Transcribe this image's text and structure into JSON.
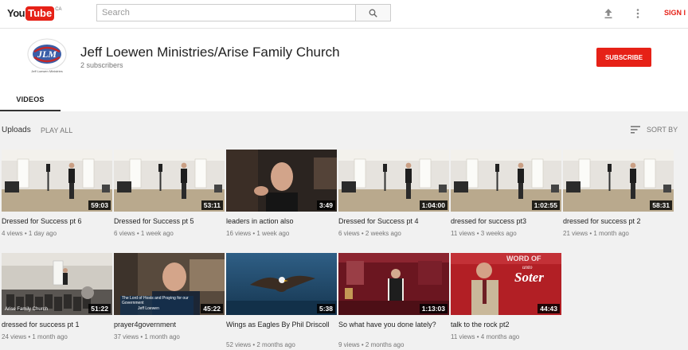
{
  "masthead": {
    "logo_you": "You",
    "logo_tube": "Tube",
    "logo_region": "CA",
    "search_placeholder": "Search",
    "sign_in": "SIGN I"
  },
  "channel": {
    "title": "Jeff Loewen Ministries/Arise Family Church",
    "subscribers": "2 subscribers",
    "subscribe_label": "SUBSCRIBE",
    "avatar_text": "JLM",
    "avatar_caption": "Jeff Loewen Ministries",
    "tab_videos": "VIDEOS"
  },
  "section": {
    "uploads": "Uploads",
    "play_all": "PLAY ALL",
    "sort_by": "SORT BY"
  },
  "videos": [
    {
      "title": "Dressed for Success pt 6",
      "meta": "4 views • 1 day ago",
      "duration": "59:03",
      "thumb": "hall-speaker"
    },
    {
      "title": "Dressed for Success pt 5",
      "meta": "6 views • 1 week ago",
      "duration": "53:11",
      "thumb": "hall-speaker"
    },
    {
      "title": "leaders in action also",
      "meta": "16 views • 1 week ago",
      "duration": "3:49",
      "thumb": "selfie-man"
    },
    {
      "title": "Dressed for Success pt 4",
      "meta": "6 views • 2 weeks ago",
      "duration": "1:04:00",
      "thumb": "hall-speaker"
    },
    {
      "title": "dressed for success pt3",
      "meta": "11 views • 3 weeks ago",
      "duration": "1:02:55",
      "thumb": "hall-speaker"
    },
    {
      "title": "dressed for success pt 2",
      "meta": "21 views • 1 month ago",
      "duration": "58:31",
      "thumb": "hall-speaker"
    },
    {
      "title": "dressed for success pt 1",
      "meta": "24 views • 1 month ago",
      "duration": "51:22",
      "thumb": "hall-audience",
      "overlay": "Arise Family Church"
    },
    {
      "title": "prayer4government",
      "meta": "37 views • 1 month ago",
      "duration": "45:22",
      "thumb": "office-man",
      "overlay": "The Lord of Hosts and Praying for our Government",
      "overlay2": "Jeff Loewen"
    },
    {
      "title": "Wings as Eagles By Phil Driscoll",
      "meta": "52 views • 2 months ago",
      "duration": "5:38",
      "thumb": "eagle"
    },
    {
      "title": "So what have you done lately?",
      "meta": "9 views • 2 months ago",
      "duration": "1:13:03",
      "thumb": "stage-man"
    },
    {
      "title": "talk to the rock pt2",
      "meta": "11 views • 4 months ago",
      "duration": "44:43",
      "thumb": "soter-man",
      "overlay": "Soter",
      "overlay2": "WORD OF",
      "overlay3": "unto"
    }
  ]
}
